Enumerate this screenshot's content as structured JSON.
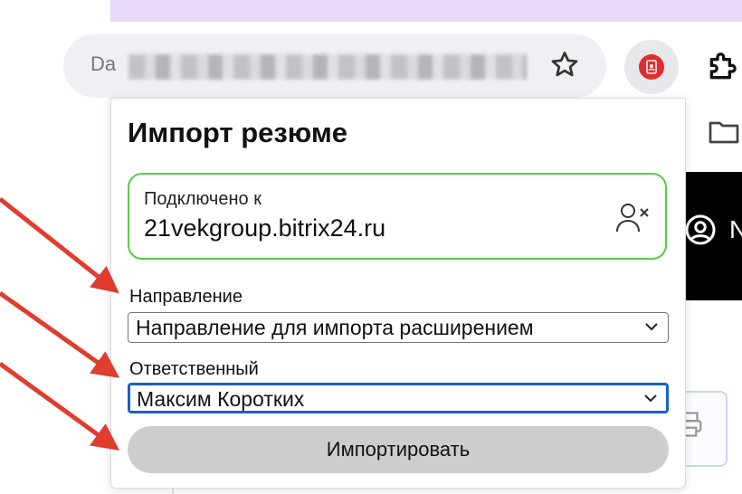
{
  "browser": {
    "address_fragment": "Da",
    "bookmark_star": "star-icon",
    "extension_icon": "resume-import-extension",
    "puzzle_icon": "extensions-icon",
    "page_partial_text": "N"
  },
  "popup": {
    "title": "Импорт резюме",
    "connection": {
      "label": "Подключено к",
      "domain": "21vekgroup.bitrix24.ru",
      "border_color": "#55cc44"
    },
    "direction": {
      "label": "Направление",
      "selected": "Направление для импорта расширением"
    },
    "responsible": {
      "label": "Ответственный",
      "selected": "Максим Коротких"
    },
    "import_button": "Импортировать"
  },
  "annotation_arrow_color": "#e03c2f"
}
